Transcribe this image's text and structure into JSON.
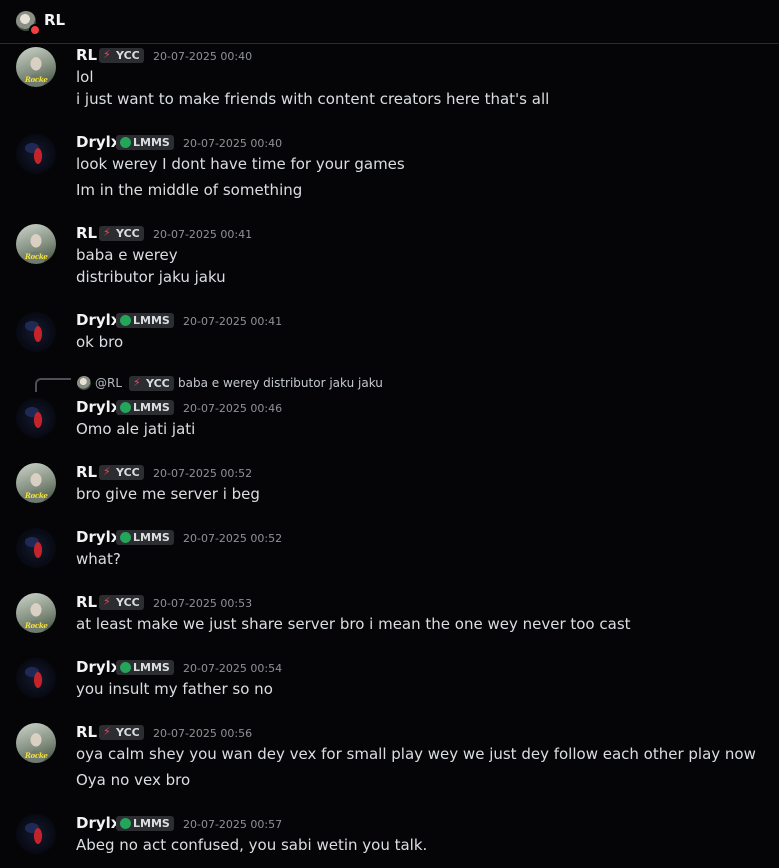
{
  "header": {
    "title": "RL"
  },
  "users": {
    "rl": {
      "name": "RL",
      "badge": "YCC",
      "badge_color": "#e34a5a"
    },
    "drylx": {
      "name": "Drylx",
      "badge": "LMMS",
      "badge_color": "#23a55a"
    }
  },
  "avatar_text": {
    "rl": "Rocke"
  },
  "reply": {
    "mention": "@RL",
    "badge": "YCC",
    "text": "baba e werey distributor jaku jaku"
  },
  "messages": [
    {
      "user": "RL",
      "badge": "YCC",
      "time": "20-07-2025 00:40",
      "lines": [
        "lol",
        "i just want to make friends with content creators here that's all"
      ]
    },
    {
      "user": "Drylx",
      "badge": "LMMS",
      "time": "20-07-2025 00:40",
      "lines": [
        "look werey I dont have time for your games",
        "Im in the middle of something"
      ]
    },
    {
      "user": "RL",
      "badge": "YCC",
      "time": "20-07-2025 00:41",
      "lines": [
        "baba e werey",
        "distributor jaku jaku"
      ]
    },
    {
      "user": "Drylx",
      "badge": "LMMS",
      "time": "20-07-2025 00:41",
      "lines": [
        "ok bro"
      ]
    },
    {
      "user": "Drylx",
      "badge": "LMMS",
      "time": "20-07-2025 00:46",
      "lines": [
        "Omo ale jati jati"
      ]
    },
    {
      "user": "RL",
      "badge": "YCC",
      "time": "20-07-2025 00:52",
      "lines": [
        "bro give me server i beg"
      ]
    },
    {
      "user": "Drylx",
      "badge": "LMMS",
      "time": "20-07-2025 00:52",
      "lines": [
        "what?"
      ]
    },
    {
      "user": "RL",
      "badge": "YCC",
      "time": "20-07-2025 00:53",
      "lines": [
        "at least make we just share server bro i mean the one wey never too cast"
      ]
    },
    {
      "user": "Drylx",
      "badge": "LMMS",
      "time": "20-07-2025 00:54",
      "lines": [
        "you insult my father so no"
      ]
    },
    {
      "user": "RL",
      "badge": "YCC",
      "time": "20-07-2025 00:56",
      "lines": [
        "oya calm shey you wan dey vex for small play wey we just dey follow each other play now",
        "Oya no vex bro"
      ]
    },
    {
      "user": "Drylx",
      "badge": "LMMS",
      "time": "20-07-2025 00:57",
      "lines": [
        "Abeg no act confused, you sabi wetin you talk."
      ]
    }
  ]
}
